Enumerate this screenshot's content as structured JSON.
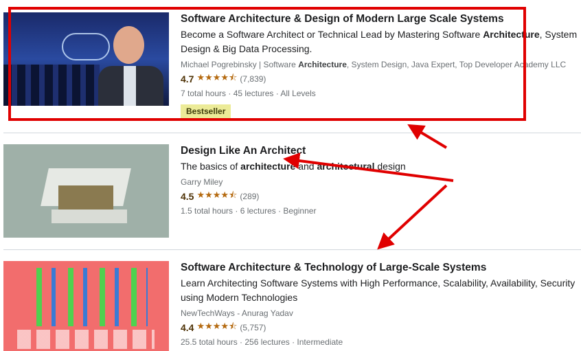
{
  "courses": [
    {
      "title": "Software Architecture & Design of Modern Large Scale Systems",
      "desc": [
        {
          "t": "Become a Software Architect or Technical Lead by Mastering Software "
        },
        {
          "t": "Architecture",
          "b": true
        },
        {
          "t": ", System Design & Big Data Processing."
        }
      ],
      "instructor": [
        {
          "t": "Michael Pogrebinsky | Software "
        },
        {
          "t": "Architecture",
          "b": true
        },
        {
          "t": ", System Design, Java Expert, Top Developer Academy LLC"
        }
      ],
      "rating": "4.7",
      "stars": 4.5,
      "count": "(7,839)",
      "meta": "7 total hours · 45 lectures · All Levels",
      "badge": "Bestseller"
    },
    {
      "title": "Design Like An Architect",
      "desc": [
        {
          "t": "The basics of "
        },
        {
          "t": "architecture",
          "b": true
        },
        {
          "t": " and "
        },
        {
          "t": "architectural",
          "b": true
        },
        {
          "t": " design"
        }
      ],
      "instructor": [
        {
          "t": "Garry Miley"
        }
      ],
      "rating": "4.5",
      "stars": 4.5,
      "count": "(289)",
      "meta": "1.5 total hours · 6 lectures · Beginner"
    },
    {
      "title": "Software Architecture & Technology of Large-Scale Systems",
      "desc": [
        {
          "t": "Learn Architecting Software Systems with High Performance, Scalability, Availability, Security using Modern Technologies"
        }
      ],
      "instructor": [
        {
          "t": "NewTechWays - Anurag Yadav"
        }
      ],
      "rating": "4.4",
      "stars": 4.5,
      "count": "(5,757)",
      "meta": "25.5 total hours · 256 lectures · Intermediate"
    }
  ],
  "stars_glyph": "★★★★⯪",
  "colors": {
    "highlight": "#e00000",
    "star": "#b4690e",
    "badge_bg": "#eceb98"
  }
}
